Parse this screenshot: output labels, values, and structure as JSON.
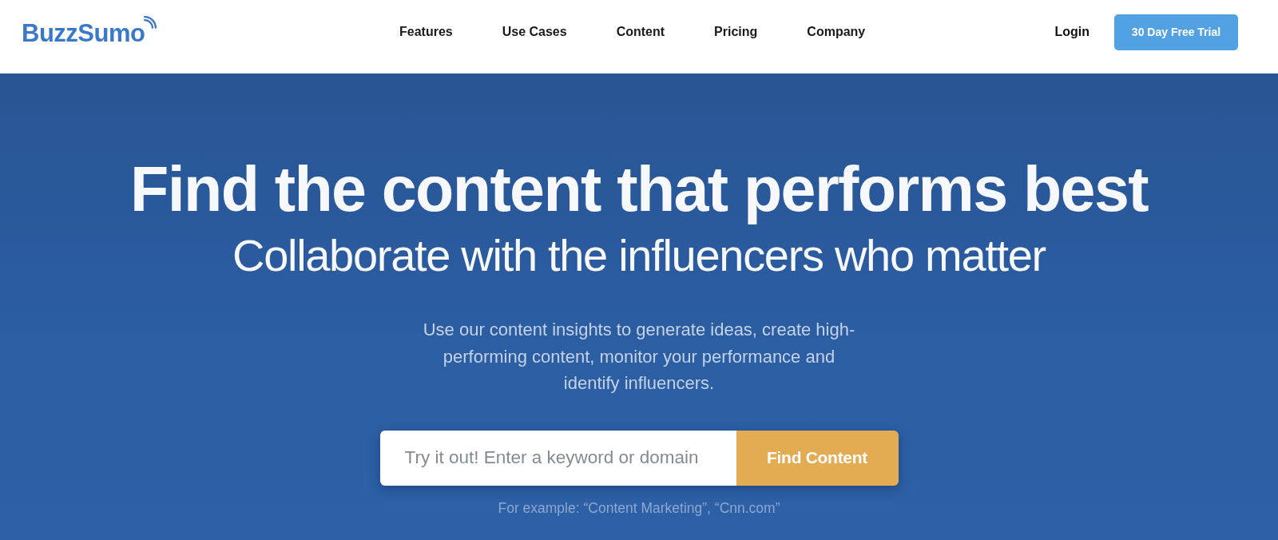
{
  "header": {
    "logo": {
      "text": "BuzzSumo"
    },
    "nav": [
      {
        "label": "Features"
      },
      {
        "label": "Use Cases"
      },
      {
        "label": "Content"
      },
      {
        "label": "Pricing"
      },
      {
        "label": "Company"
      }
    ],
    "login": "Login",
    "cta": "30 Day Free Trial"
  },
  "hero": {
    "title": "Find the content that performs best",
    "subtitle": "Collaborate with the influencers who matter",
    "description": "Use our content insights to generate ideas, create high-performing content, monitor your performance and identify influencers.",
    "search": {
      "placeholder": "Try it out! Enter a keyword or domain",
      "button": "Find Content"
    },
    "example": "For example: “Content Marketing”, “Cnn.com”"
  }
}
